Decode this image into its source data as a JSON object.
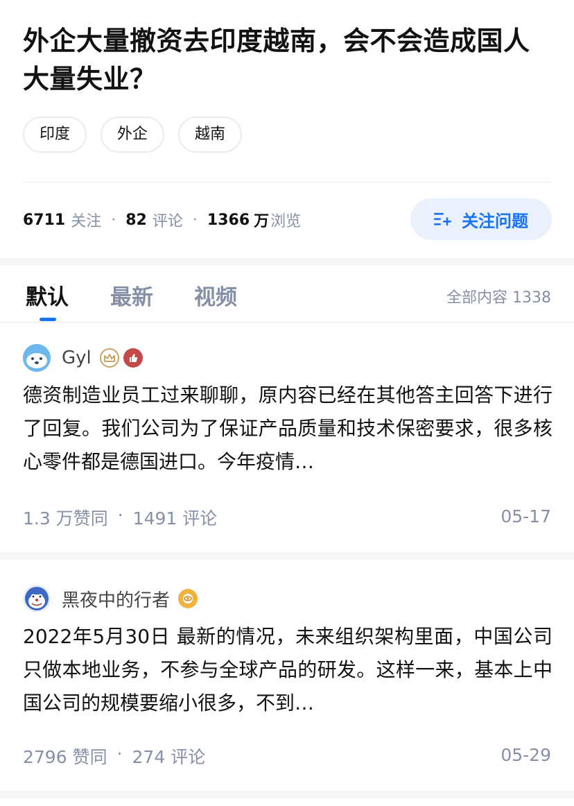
{
  "question": {
    "title": "外企大量撤资去印度越南，会不会造成国人大量失业？",
    "tags": [
      "印度",
      "外企",
      "越南"
    ],
    "stats": {
      "followers": "6711",
      "followers_label": "关注",
      "comments": "82",
      "comments_label": "评论",
      "views": "1366",
      "views_unit": "万",
      "views_label": "浏览"
    },
    "follow_button": "关注问题"
  },
  "tabs": {
    "items": [
      "默认",
      "最新",
      "视频"
    ],
    "active": "默认",
    "total_label": "全部内容 1338"
  },
  "answers": [
    {
      "author": "Gyl",
      "text": "德资制造业员工过来聊聊，原内容已经在其他答主回答下进行了回复。我们公司为了保证产品质量和技术保密要求，很多核心零件都是德国进口。今年疫情…",
      "votes": "1.3 万赞同",
      "comments": "1491 评论",
      "date": "05-17"
    },
    {
      "author": "黑夜中的行者",
      "text": "2022年5月30日 最新的情况，未来组织架构里面，中国公司只做本地业务，不参与全球产品的研发。这样一来，基本上中国公司的规模要缩小很多，不到…",
      "votes": "2796 赞同",
      "comments": "274 评论",
      "date": "05-29"
    }
  ],
  "colors": {
    "accent": "#1772f6",
    "follow_bg": "#eaf1fd",
    "muted": "#8590a6",
    "divider": "#f5f6f7"
  }
}
